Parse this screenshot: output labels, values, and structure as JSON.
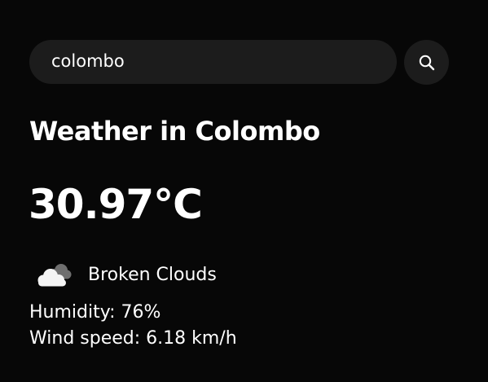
{
  "search": {
    "value": "colombo",
    "button_icon": "search-icon"
  },
  "weather": {
    "title": "Weather in Colombo",
    "temperature": "30.97°C",
    "condition_icon": "broken-clouds-icon",
    "condition": "Broken Clouds",
    "humidity": "Humidity: 76%",
    "wind": "Wind speed: 6.18 km/h"
  },
  "colors": {
    "background": "#070707",
    "control_background": "#1c1c1c",
    "text": "#ffffff"
  }
}
